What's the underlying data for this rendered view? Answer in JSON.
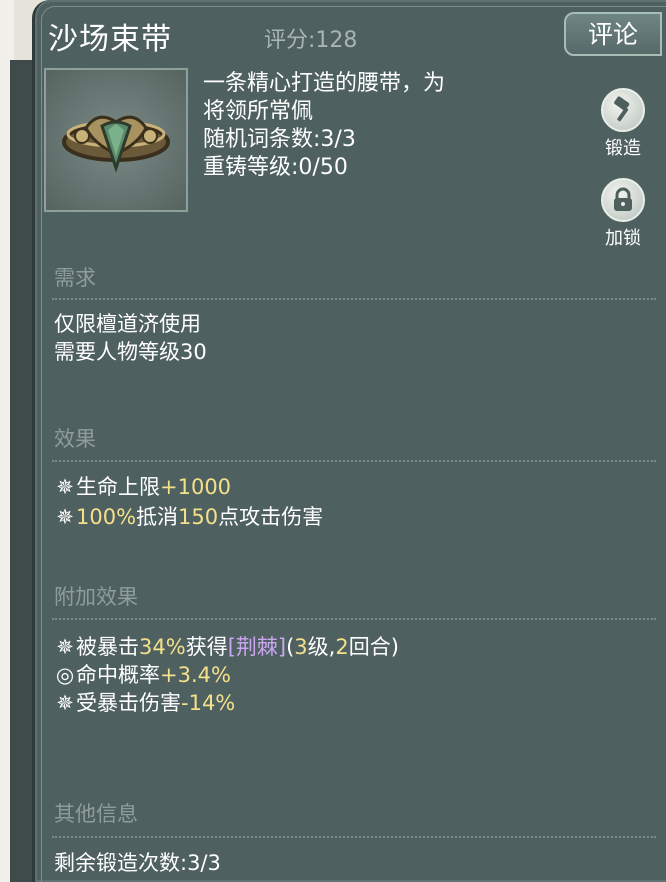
{
  "item": {
    "name": "沙场束带",
    "score": "评分:128",
    "comment_label": "评论",
    "desc_line1": "一条精心打造的腰带，为",
    "desc_line2": "将领所常佩",
    "random_entries": "随机词条数:3/3",
    "recast_level": "重铸等级:0/50"
  },
  "actions": {
    "forge_label": "锻造",
    "lock_label": "加锁"
  },
  "requirements": {
    "heading": "需求",
    "lines": [
      "仅限檀道济使用",
      "需要人物等级30"
    ]
  },
  "effects": {
    "heading": "效果",
    "line1_text": "生命上限",
    "line1_value": "+1000",
    "line2_pct": "100%",
    "line2_mid": "抵消",
    "line2_num": "150",
    "line2_end": "点攻击伤害"
  },
  "extra_effects": {
    "heading": "附加效果",
    "e1_a": "被暴击",
    "e1_pct": "34%",
    "e1_b": "获得",
    "e1_tag": "[荆棘]",
    "e1_c1": "(",
    "e1_level": "3",
    "e1_c2": "级,",
    "e1_rounds": "2",
    "e1_c3": "回合)",
    "e2_text": "命中概率",
    "e2_value": "+3.4%",
    "e3_text": "受暴击伤害",
    "e3_value": "-14%"
  },
  "other": {
    "heading": "其他信息",
    "forge_remaining": "剩余锻造次数:3/3"
  },
  "colors": {
    "panel": "#4f6061",
    "highlight": "#f5e08a",
    "tag": "#caa6f0"
  },
  "icons": {
    "item": "belt-icon",
    "forge": "hammer-icon",
    "lock": "lock-icon",
    "effect_bullet": "star-bullet-icon",
    "accuracy_bullet": "target-icon"
  }
}
